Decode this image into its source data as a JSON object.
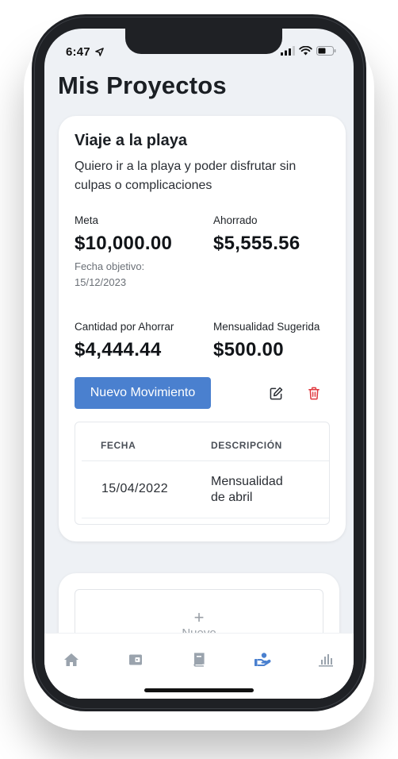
{
  "status_bar": {
    "time": "6:47"
  },
  "page": {
    "title": "Mis Proyectos"
  },
  "project": {
    "title": "Viaje a la playa",
    "description": "Quiero ir a la playa y poder disfrutar sin culpas o complicaciones",
    "goal_label": "Meta",
    "goal_value": "$10,000.00",
    "target_date_label": "Fecha objetivo:",
    "target_date": "15/12/2023",
    "saved_label": "Ahorrado",
    "saved_value": "$5,555.56",
    "remaining_label": "Cantidad por Ahorrar",
    "remaining_value": "$4,444.44",
    "suggested_label": "Mensualidad Sugerida",
    "suggested_value": "$500.00",
    "new_movement_label": "Nuevo Movimiento",
    "table": {
      "headers": [
        "FECHA",
        "DESCRIPCIÓN"
      ],
      "rows": [
        {
          "date": "15/04/2022",
          "description": "Mensualidad de abril"
        }
      ]
    }
  },
  "new_project": {
    "plus": "+",
    "label": "Nuevo"
  },
  "tabbar": {
    "items": [
      "home-icon",
      "wallet-icon",
      "book-icon",
      "savings-hand-icon",
      "chart-icon"
    ],
    "active_index": 3
  },
  "colors": {
    "accent": "#4a80cf",
    "delete": "#e0383e",
    "tab_inactive": "#9aa3ad",
    "tab_active": "#4a80cf"
  }
}
